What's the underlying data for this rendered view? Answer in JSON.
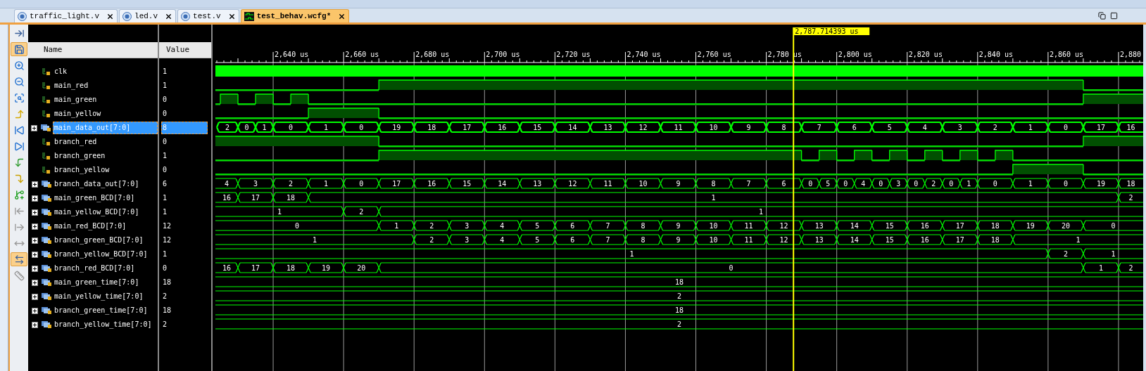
{
  "tabs": [
    {
      "label": "traffic_light.v",
      "kind": "verilog",
      "selected": false
    },
    {
      "label": "led.v",
      "kind": "verilog",
      "selected": false
    },
    {
      "label": "test.v",
      "kind": "verilog",
      "selected": false
    },
    {
      "label": "test_behav.wcfg*",
      "kind": "wave",
      "selected": true
    }
  ],
  "toolbar": [
    {
      "kind": "snap",
      "selected": false,
      "disabled": false
    },
    {
      "kind": "save",
      "selected": true,
      "disabled": false
    },
    {
      "kind": "zoom_in",
      "selected": false,
      "disabled": false
    },
    {
      "kind": "zoom_out",
      "selected": false,
      "disabled": false
    },
    {
      "kind": "zoom_fit",
      "selected": false,
      "disabled": false
    },
    {
      "kind": "goto_cursor",
      "selected": false,
      "disabled": false
    },
    {
      "kind": "goto_start",
      "selected": false,
      "disabled": false
    },
    {
      "kind": "goto_end",
      "selected": false,
      "disabled": false
    },
    {
      "kind": "prev_transition",
      "selected": false,
      "disabled": false
    },
    {
      "kind": "next_transition",
      "selected": false,
      "disabled": false
    },
    {
      "kind": "add_marker",
      "selected": false,
      "disabled": false
    },
    {
      "kind": "prev_marker",
      "selected": false,
      "disabled": true
    },
    {
      "kind": "next_marker",
      "selected": false,
      "disabled": true
    },
    {
      "kind": "marker_width",
      "selected": false,
      "disabled": true
    },
    {
      "kind": "swap_cursors",
      "selected": true,
      "disabled": false
    },
    {
      "kind": "ruler",
      "selected": false,
      "disabled": true
    }
  ],
  "header": {
    "name": "Name",
    "value": "Value"
  },
  "ruler": {
    "ticks": [
      "2,640 us",
      "2,660 us",
      "2,680 us",
      "2,700 us",
      "2,720 us",
      "2,740 us",
      "2,760 us",
      "2,780 us",
      "2,800 us",
      "2,820 us",
      "2,840 us",
      "2,860 us",
      "2,880"
    ]
  },
  "cursor": {
    "label": "2,787.714393 us"
  },
  "signals": [
    {
      "name": "clk",
      "value": "1",
      "kind": "clock",
      "selected": false,
      "wave": [
        {
          "high": true
        }
      ]
    },
    {
      "name": "main_red",
      "value": "1",
      "kind": "bit",
      "selected": false,
      "wave": [
        {
          "high": false
        },
        {
          "high": true
        },
        {
          "high": false
        }
      ]
    },
    {
      "name": "main_green",
      "value": "0",
      "kind": "bit",
      "selected": false,
      "wave": [
        {
          "high": false
        },
        {
          "high": true
        },
        {
          "high": false
        },
        {
          "high": true
        },
        {
          "high": false
        },
        {
          "high": true
        },
        {
          "high": false
        },
        {
          "high": true
        }
      ]
    },
    {
      "name": "main_yellow",
      "value": "0",
      "kind": "bit",
      "selected": false,
      "wave": [
        {
          "high": false
        },
        {
          "high": true
        },
        {
          "high": false
        }
      ]
    },
    {
      "name": "main_data_out[7:0]",
      "value": "8",
      "kind": "bus",
      "selected": true,
      "expanded": false,
      "wave": [
        "2",
        "0",
        "1",
        "0",
        "1",
        "0",
        "19",
        "18",
        "17",
        "16",
        "15",
        "14",
        "13",
        "12",
        "11",
        "10",
        "9",
        "8",
        "7",
        "6",
        "5",
        "4",
        "3",
        "2",
        "1",
        "0",
        "17",
        "16"
      ]
    },
    {
      "name": "branch_red",
      "value": "0",
      "kind": "bit",
      "selected": false,
      "wave": [
        {
          "high": true
        },
        {
          "high": false
        },
        {
          "high": true
        }
      ]
    },
    {
      "name": "branch_green",
      "value": "1",
      "kind": "bit",
      "selected": false,
      "wave": [
        {
          "high": false
        },
        {
          "high": true
        },
        {
          "high": false
        },
        {
          "high": true
        },
        {
          "high": false
        },
        {
          "high": true
        },
        {
          "high": false
        },
        {
          "high": true
        },
        {
          "high": false
        },
        {
          "high": true
        },
        {
          "high": false
        },
        {
          "high": true
        },
        {
          "high": false
        },
        {
          "high": true
        },
        {
          "high": false
        }
      ]
    },
    {
      "name": "branch_yellow",
      "value": "0",
      "kind": "bit",
      "selected": false,
      "wave": [
        {
          "high": false
        },
        {
          "high": true
        },
        {
          "high": false
        }
      ]
    },
    {
      "name": "branch_data_out[7:0]",
      "value": "6",
      "kind": "bus",
      "selected": false,
      "expanded": false,
      "wave": [
        "4",
        "3",
        "2",
        "1",
        "0",
        "17",
        "16",
        "15",
        "14",
        "13",
        "12",
        "11",
        "10",
        "9",
        "8",
        "7",
        "6",
        "0",
        "5",
        "0",
        "4",
        "0",
        "3",
        "0",
        "2",
        "0",
        "1",
        "0",
        "1",
        "0",
        "19",
        "18"
      ]
    },
    {
      "name": "main_green_BCD[7:0]",
      "value": "1",
      "kind": "bus",
      "selected": false,
      "expanded": false,
      "wave": [
        "16",
        "17",
        "18",
        "1",
        "2"
      ]
    },
    {
      "name": "main_yellow_BCD[7:0]",
      "value": "1",
      "kind": "bus",
      "selected": false,
      "expanded": false,
      "wave": [
        "1",
        "2",
        "1"
      ]
    },
    {
      "name": "main_red_BCD[7:0]",
      "value": "12",
      "kind": "bus",
      "selected": false,
      "expanded": false,
      "wave": [
        "0",
        "1",
        "2",
        "3",
        "4",
        "5",
        "6",
        "7",
        "8",
        "9",
        "10",
        "11",
        "12",
        "13",
        "14",
        "15",
        "16",
        "17",
        "18",
        "19",
        "20",
        "0"
      ]
    },
    {
      "name": "branch_green_BCD[7:0]",
      "value": "12",
      "kind": "bus",
      "selected": false,
      "expanded": false,
      "wave": [
        "1",
        "2",
        "3",
        "4",
        "5",
        "6",
        "7",
        "8",
        "9",
        "10",
        "11",
        "12",
        "13",
        "14",
        "15",
        "16",
        "17",
        "18",
        "1"
      ]
    },
    {
      "name": "branch_yellow_BCD[7:0]",
      "value": "1",
      "kind": "bus",
      "selected": false,
      "expanded": false,
      "wave": [
        "1",
        "2",
        "1"
      ]
    },
    {
      "name": "branch_red_BCD[7:0]",
      "value": "0",
      "kind": "bus",
      "selected": false,
      "expanded": false,
      "wave": [
        "16",
        "17",
        "18",
        "19",
        "20",
        "0",
        "1",
        "2"
      ]
    },
    {
      "name": "main_green_time[7:0]",
      "value": "18",
      "kind": "bus",
      "selected": false,
      "expanded": false,
      "wave": [
        "18"
      ]
    },
    {
      "name": "main_yellow_time[7:0]",
      "value": "2",
      "kind": "bus",
      "selected": false,
      "expanded": false,
      "wave": [
        "2"
      ]
    },
    {
      "name": "branch_green_time[7:0]",
      "value": "18",
      "kind": "bus",
      "selected": false,
      "expanded": false,
      "wave": [
        "18"
      ]
    },
    {
      "name": "branch_yellow_time[7:0]",
      "value": "2",
      "kind": "bus",
      "selected": false,
      "expanded": false,
      "wave": [
        "2"
      ]
    }
  ]
}
